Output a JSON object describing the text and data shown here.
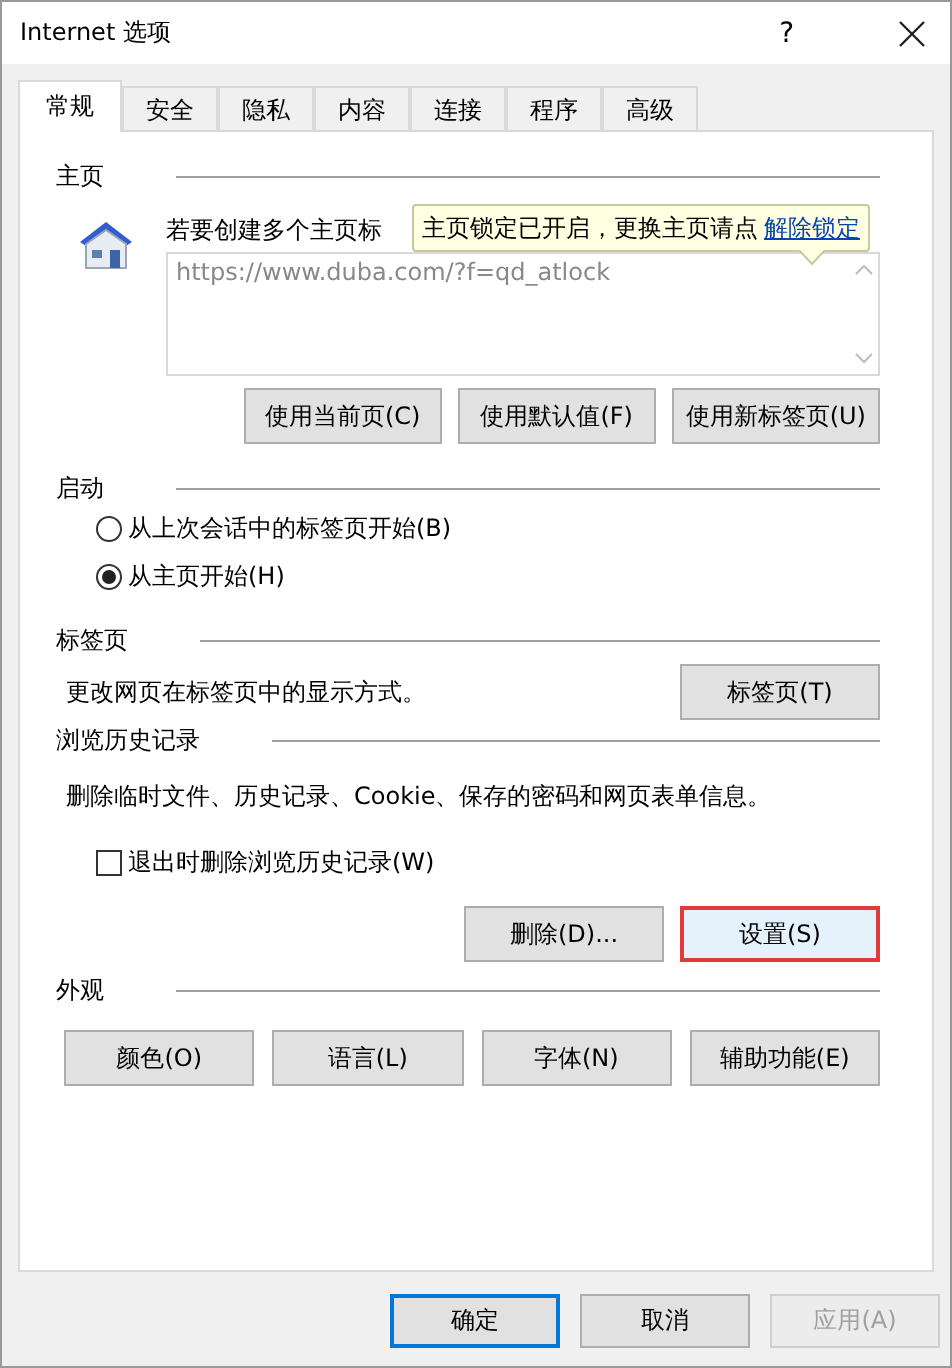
{
  "window": {
    "title": "Internet 选项",
    "help": "?"
  },
  "tabs": [
    {
      "label": "常规",
      "selected": true
    },
    {
      "label": "安全",
      "selected": false
    },
    {
      "label": "隐私",
      "selected": false
    },
    {
      "label": "内容",
      "selected": false
    },
    {
      "label": "连接",
      "selected": false
    },
    {
      "label": "程序",
      "selected": false
    },
    {
      "label": "高级",
      "selected": false
    }
  ],
  "home": {
    "label": "主页",
    "description": "若要创建多个主页标",
    "tooltip": {
      "text": "主页锁定已开启，更换主页请点",
      "link": "解除锁定"
    },
    "url": "https://www.duba.com/?f=qd_atlock",
    "buttons": [
      {
        "label": "使用当前页(C)"
      },
      {
        "label": "使用默认值(F)"
      },
      {
        "label": "使用新标签页(U)"
      }
    ]
  },
  "startup": {
    "label": "启动",
    "options": [
      {
        "label": "从上次会话中的标签页开始(B)",
        "selected": false
      },
      {
        "label": "从主页开始(H)",
        "selected": true
      }
    ]
  },
  "tab_settings": {
    "label": "标签页",
    "description": "更改网页在标签页中的显示方式。",
    "button": "标签页(T)"
  },
  "history": {
    "label": "浏览历史记录",
    "description": "删除临时文件、历史记录、Cookie、保存的密码和网页表单信息。",
    "checkbox": {
      "label": "退出时删除浏览历史记录(W)",
      "checked": false
    },
    "buttons": [
      {
        "label": "删除(D)...",
        "highlighted": false
      },
      {
        "label": "设置(S)",
        "highlighted": true
      }
    ]
  },
  "appearance": {
    "label": "外观",
    "buttons": [
      {
        "label": "颜色(O)"
      },
      {
        "label": "语言(L)"
      },
      {
        "label": "字体(N)"
      },
      {
        "label": "辅助功能(E)"
      }
    ]
  },
  "footer_buttons": [
    {
      "label": "确定",
      "default": true,
      "disabled": false
    },
    {
      "label": "取消",
      "default": false,
      "disabled": false
    },
    {
      "label": "应用(A)",
      "default": false,
      "disabled": true
    }
  ]
}
